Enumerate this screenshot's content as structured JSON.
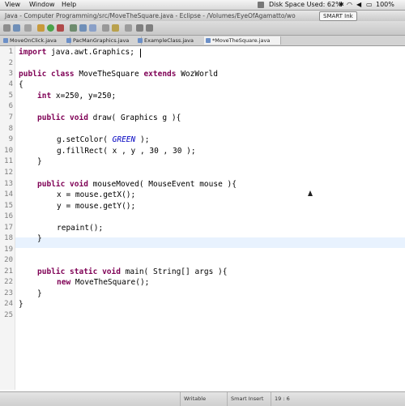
{
  "menubar": {
    "menus": [
      "View",
      "Window",
      "Help"
    ],
    "disk_space": "Disk Space Used: 62%",
    "battery": "100%"
  },
  "window": {
    "title": "Java - Computer Programming/src/MoveTheSquare.java - Eclipse - /Volumes/EyeOfAgamatto/wo",
    "smart_ink_label": "SMART Ink"
  },
  "tabs": [
    {
      "label": "MoveOnClick.java"
    },
    {
      "label": "PacManGraphics.java"
    },
    {
      "label": "ExampleClass.java"
    },
    {
      "label": "*MoveTheSquare.java"
    }
  ],
  "editor": {
    "line_numbers": [
      "1",
      "2",
      "3",
      "4",
      "5",
      "6",
      "7",
      "8",
      "9",
      "10",
      "11",
      "12",
      "13",
      "14",
      "15",
      "16",
      "17",
      "18",
      "19",
      "20",
      "21",
      "22",
      "23",
      "24",
      "25"
    ],
    "lines": {
      "l1_a": "import",
      "l1_b": " java.awt.Graphics;",
      "l3_a": "public class",
      "l3_b": " MoveTheSquare ",
      "l3_c": "extends",
      "l3_d": " WozWorld",
      "l4": "{",
      "l6_a": "int",
      "l6_b": " x=250, y=250;",
      "l8_a": "public void",
      "l8_b": " draw( Graphics g ){",
      "l10_a": "g.setColor( ",
      "l10_b": "GREEN",
      "l10_c": " );",
      "l11": "g.fillRect( x , y , 30 , 30 );",
      "l12": "}",
      "l14_a": "public void",
      "l14_b": " mouseMoved( MouseEvent mouse ){",
      "l15": "x = mouse.getX();",
      "l16": "y = mouse.getY();",
      "l18": "repaint();",
      "l19": "}",
      "l22_a": "public static void",
      "l22_b": " main( String[] args ){",
      "l23_a": "new",
      "l23_b": " MoveTheSquare();",
      "l24": "}",
      "l25": "}"
    }
  },
  "statusbar": {
    "writable": "Writable",
    "insert_mode": "Smart Insert",
    "position": "19 : 6"
  },
  "colors": {
    "keyword": "#7f0055",
    "field": "#0000c0",
    "current_line": "#e8f2fe"
  }
}
